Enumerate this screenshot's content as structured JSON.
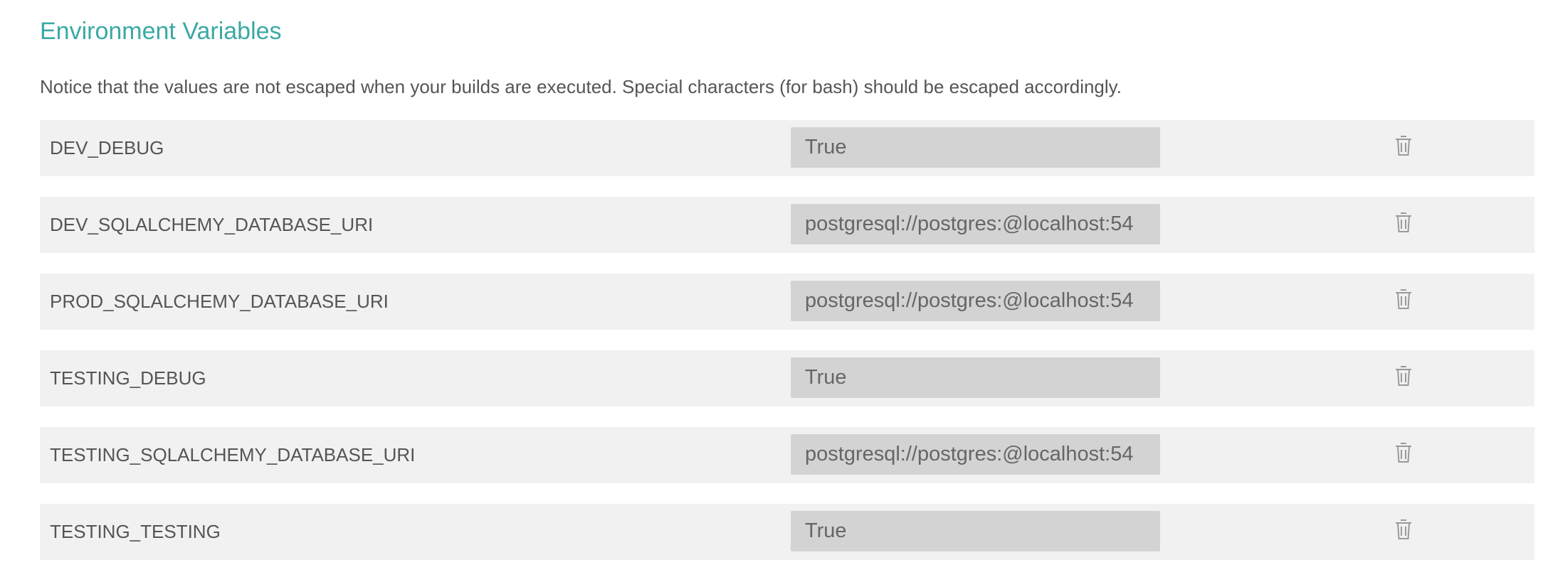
{
  "section": {
    "title": "Environment Variables",
    "notice": "Notice that the values are not escaped when your builds are executed. Special characters (for bash) should be escaped accordingly."
  },
  "colors": {
    "title": "#3aa9a5",
    "row_background": "#f1f1f1",
    "value_background": "#d3d3d3",
    "text": "#555555",
    "icon": "#9a9a9a"
  },
  "variables": [
    {
      "name": "DEV_DEBUG",
      "value": "True",
      "delete_icon": "trash-icon"
    },
    {
      "name": "DEV_SQLALCHEMY_DATABASE_URI",
      "value": "postgresql://postgres:@localhost:54",
      "delete_icon": "trash-icon"
    },
    {
      "name": "PROD_SQLALCHEMY_DATABASE_URI",
      "value": "postgresql://postgres:@localhost:54",
      "delete_icon": "trash-icon"
    },
    {
      "name": "TESTING_DEBUG",
      "value": "True",
      "delete_icon": "trash-icon"
    },
    {
      "name": "TESTING_SQLALCHEMY_DATABASE_URI",
      "value": "postgresql://postgres:@localhost:54",
      "delete_icon": "trash-icon"
    },
    {
      "name": "TESTING_TESTING",
      "value": "True",
      "delete_icon": "trash-icon"
    }
  ]
}
